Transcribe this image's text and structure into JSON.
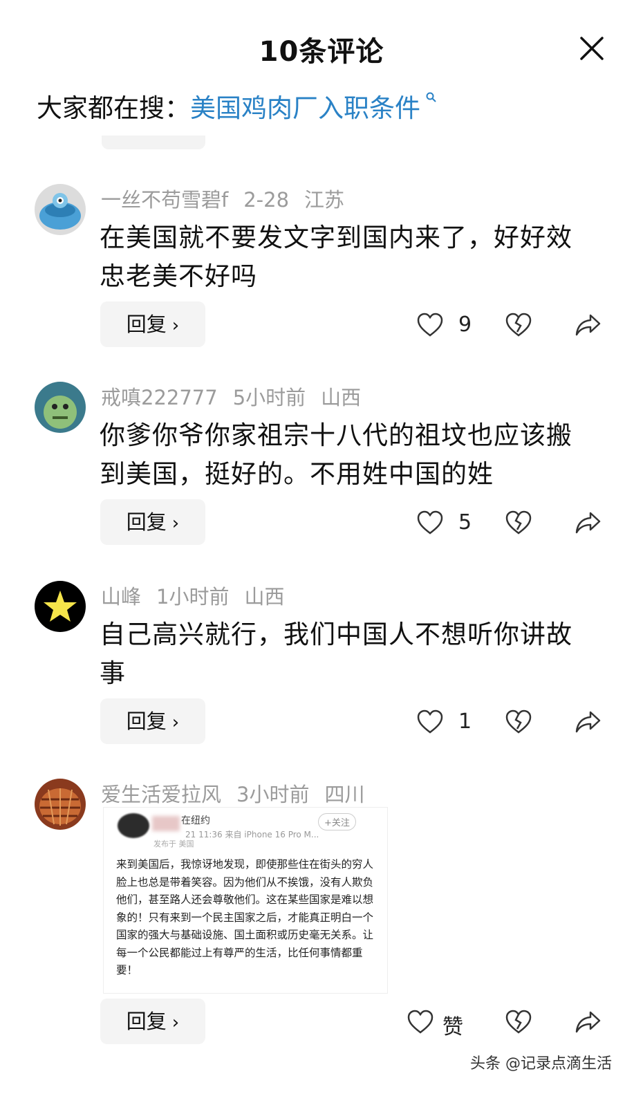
{
  "header": {
    "title": "10条评论",
    "search_prefix": "大家都在搜：",
    "search_keyword": "美国鸡肉厂入职条件",
    "search_icon": "search-icon"
  },
  "comments": [
    {
      "user": "一丝不苟雪碧f",
      "time": "2-28",
      "region": "江苏",
      "text": "在美国就不要发文字到国内来了，好好效忠老美不好吗",
      "reply_label": "回复",
      "likes": "9",
      "avatar_colors": [
        "#d6e7f2",
        "#4a9fd4"
      ]
    },
    {
      "user": "戒嗔222777",
      "time": "5小时前",
      "region": "山西",
      "text": "你爹你爷你家祖宗十八代的祖坟也应该搬到美国，挺好的。不用姓中国的姓",
      "reply_label": "回复",
      "likes": "5",
      "avatar_colors": [
        "#3b7a8c",
        "#8fc07a"
      ]
    },
    {
      "user": "山峰",
      "time": "1小时前",
      "region": "山西",
      "text": "自己高兴就行，我们中国人不想听你讲故事",
      "reply_label": "回复",
      "likes": "1",
      "avatar_colors": [
        "#000000",
        "#f5e44a"
      ]
    },
    {
      "user": "爱生活爱拉风",
      "time": "3小时前",
      "region": "四川",
      "reply_label": "回复",
      "likes": "赞",
      "avatar_colors": [
        "#8a3a1e",
        "#c96a34"
      ],
      "image": {
        "name": "在纽约",
        "time_device": "21 11:36  来自 iPhone 16 Pro M...",
        "posted_from": "发布于 美国",
        "follow": "+关注",
        "text": "来到美国后，我惊讶地发现，即使那些住在街头的穷人脸上也总是带着笑容。因为他们从不挨饿，没有人欺负他们，甚至路人还会尊敬他们。这在某些国家是难以想象的！只有来到一个民主国家之后，才能真正明白一个国家的强大与基础设施、国土面积或历史毫无关系。让每一个公民都能过上有尊严的生活，比任何事情都重要！"
      }
    }
  ],
  "watermark": "头条 @记录点滴生活"
}
